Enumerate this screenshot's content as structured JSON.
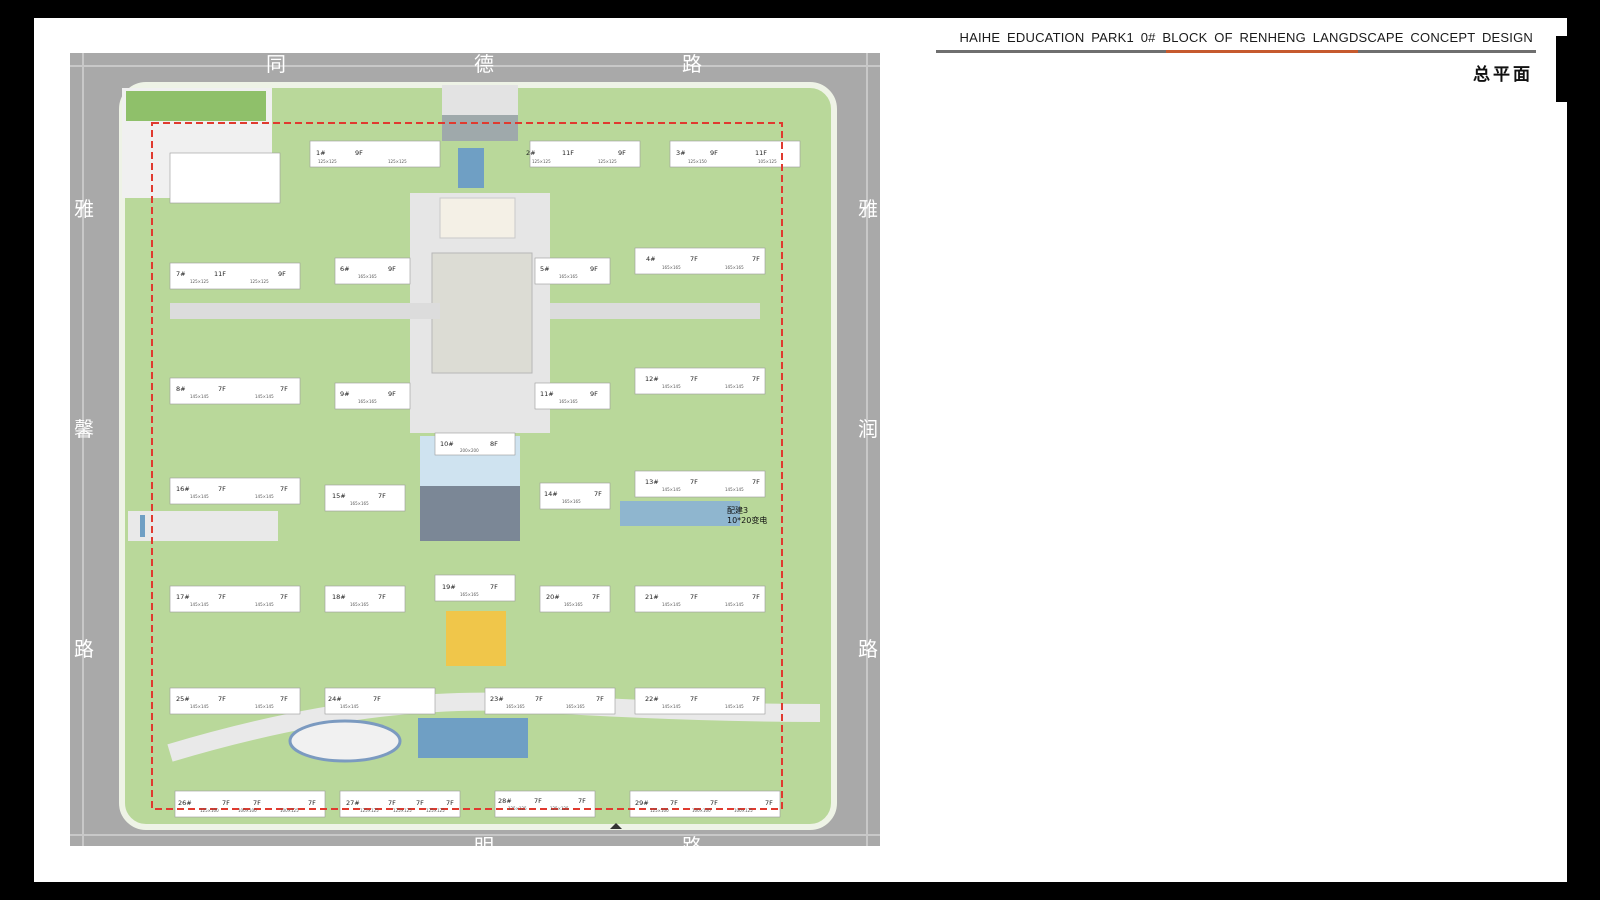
{
  "header": {
    "title": "HAIHE  EDUCATION  PARK1 0# BLOCK OF RENHENG  LANGDSCAPE  CONCEPT DESIGN",
    "subtitle": "总平面"
  },
  "colors": {
    "road": "#a9a9a9",
    "lawn": "#b9d89a",
    "lawn_dark": "#a6cc84",
    "paving": "#e6e6e6",
    "redline": "#e03a2f",
    "building": "#ffffff",
    "water": "#6f9fc4"
  },
  "roads": {
    "top": [
      "同",
      "德",
      "路"
    ],
    "left": [
      "雅",
      "馨",
      "路"
    ],
    "right": [
      "雅",
      "润",
      "路"
    ],
    "bottom": [
      "明",
      "路"
    ]
  },
  "facility_label": {
    "line1": "配建3",
    "line2": "10*20变电"
  },
  "buildings": [
    {
      "id": "b1",
      "num": "1#",
      "floors": [
        "9F"
      ],
      "sizes": [
        "125×125",
        "125×125"
      ]
    },
    {
      "id": "b2",
      "num": "2#",
      "floors": [
        "11F",
        "9F"
      ],
      "sizes": [
        "125×125",
        "125×125"
      ]
    },
    {
      "id": "b3",
      "num": "3#",
      "floors": [
        "9F",
        "11F"
      ],
      "sizes": [
        "125×150",
        "105×125"
      ]
    },
    {
      "id": "b4",
      "num": "4#",
      "floors": [
        "7F",
        "7F"
      ],
      "sizes": [
        "165×165",
        "165×165"
      ]
    },
    {
      "id": "b5",
      "num": "5#",
      "floors": [
        "9F"
      ],
      "sizes": [
        "165×165"
      ]
    },
    {
      "id": "b6",
      "num": "6#",
      "floors": [
        "9F"
      ],
      "sizes": [
        "165×165"
      ]
    },
    {
      "id": "b7",
      "num": "7#",
      "floors": [
        "11F",
        "9F"
      ],
      "sizes": [
        "125×125",
        "125×125"
      ]
    },
    {
      "id": "b8",
      "num": "8#",
      "floors": [
        "7F",
        "7F"
      ],
      "sizes": [
        "145×145",
        "145×145"
      ]
    },
    {
      "id": "b9",
      "num": "9#",
      "floors": [
        "9F"
      ],
      "sizes": [
        "165×165"
      ]
    },
    {
      "id": "b10",
      "num": "10#",
      "floors": [
        "8F"
      ],
      "sizes": [
        "200×200"
      ]
    },
    {
      "id": "b11",
      "num": "11#",
      "floors": [
        "9F"
      ],
      "sizes": [
        "165×165"
      ]
    },
    {
      "id": "b12",
      "num": "12#",
      "floors": [
        "7F",
        "7F"
      ],
      "sizes": [
        "145×145",
        "145×145"
      ]
    },
    {
      "id": "b13",
      "num": "13#",
      "floors": [
        "7F",
        "7F"
      ],
      "sizes": [
        "145×145",
        "145×145"
      ]
    },
    {
      "id": "b14",
      "num": "14#",
      "floors": [
        "7F"
      ],
      "sizes": [
        "165×165"
      ]
    },
    {
      "id": "b15",
      "num": "15#",
      "floors": [
        "7F"
      ],
      "sizes": [
        "165×165"
      ]
    },
    {
      "id": "b16",
      "num": "16#",
      "floors": [
        "7F",
        "7F"
      ],
      "sizes": [
        "145×145",
        "145×145"
      ]
    },
    {
      "id": "b17",
      "num": "17#",
      "floors": [
        "7F",
        "7F"
      ],
      "sizes": [
        "145×145",
        "145×145"
      ]
    },
    {
      "id": "b18",
      "num": "18#",
      "floors": [
        "7F"
      ],
      "sizes": [
        "165×165"
      ]
    },
    {
      "id": "b19",
      "num": "19#",
      "floors": [
        "7F"
      ],
      "sizes": [
        "165×165"
      ]
    },
    {
      "id": "b20",
      "num": "20#",
      "floors": [
        "7F"
      ],
      "sizes": [
        "165×165"
      ]
    },
    {
      "id": "b21",
      "num": "21#",
      "floors": [
        "7F",
        "7F"
      ],
      "sizes": [
        "145×145",
        "145×145"
      ]
    },
    {
      "id": "b22",
      "num": "22#",
      "floors": [
        "7F",
        "7F"
      ],
      "sizes": [
        "145×145",
        "145×145"
      ]
    },
    {
      "id": "b23",
      "num": "23#",
      "floors": [
        "7F",
        "7F"
      ],
      "sizes": [
        "165×165",
        "165×165"
      ]
    },
    {
      "id": "b24",
      "num": "24#",
      "floors": [
        "7F"
      ],
      "sizes": [
        "145×145"
      ]
    },
    {
      "id": "b25",
      "num": "25#",
      "floors": [
        "7F",
        "7F"
      ],
      "sizes": [
        "145×145",
        "145×145"
      ]
    },
    {
      "id": "b26",
      "num": "26#",
      "floors": [
        "7F",
        "7F",
        "7F"
      ],
      "sizes": [
        "125×100",
        "100×100",
        "100×125"
      ]
    },
    {
      "id": "b27",
      "num": "27#",
      "floors": [
        "7F",
        "7F",
        "7F"
      ],
      "sizes": [
        "125×125",
        "125×125",
        "125×125"
      ]
    },
    {
      "id": "b28",
      "num": "28#",
      "floors": [
        "7F",
        "7F"
      ],
      "sizes": [
        "125×125",
        "125×125"
      ]
    },
    {
      "id": "b29",
      "num": "29#",
      "floors": [
        "7F",
        "7F",
        "7F"
      ],
      "sizes": [
        "125×100",
        "100×100",
        "100×125"
      ]
    }
  ]
}
